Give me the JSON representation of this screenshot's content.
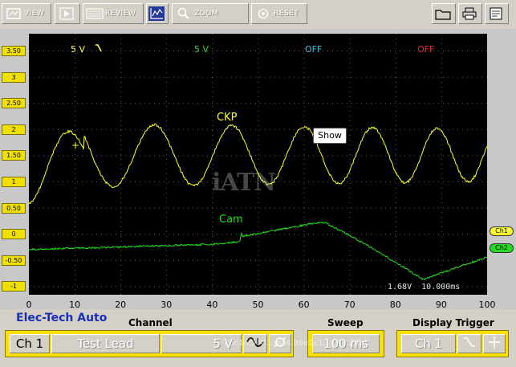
{
  "toolbar": {
    "view_label": "VIEW",
    "review_label": "REVIEW",
    "zoom_label": "ZOOM",
    "reset_label": "RESET"
  },
  "channels_header": {
    "ch1_scale": "5 V",
    "ch2_scale": "5 V",
    "ch3_state": "OFF",
    "ch4_state": "OFF"
  },
  "colors": {
    "ch1": "#ffff30",
    "ch2": "#22dd22",
    "ch3": "#40c0e0",
    "ch4": "#e03030",
    "grid": "#606060",
    "brand": "#1a2fb8"
  },
  "y_axis_labels": [
    "3.50",
    "3",
    "2.50",
    "2",
    "1.50",
    "1",
    "0.50",
    "0",
    "-0.50",
    "-1"
  ],
  "x_axis_labels": [
    "0",
    "10",
    "20",
    "30",
    "40",
    "50",
    "60",
    "70",
    "80",
    "90",
    "100"
  ],
  "traces": {
    "ckp_label": "CKP",
    "cam_label": "Cam"
  },
  "tooltip": {
    "text": "Show"
  },
  "watermark": {
    "text": "iATN"
  },
  "cursor_readout": {
    "voltage": "1.68V",
    "time": "10.000ms"
  },
  "markers": {
    "ch1": "Ch1",
    "ch2": "Ch2"
  },
  "bottom": {
    "brand": "Elec-Tech Auto",
    "channel_title": "Channel",
    "sweep_title": "Sweep",
    "trigger_title": "Display Trigger",
    "channel_select": "Ch 1",
    "probe": "Test Lead",
    "scale": "5 V",
    "sweep_value": "100 ms",
    "trigger_channel": "Ch 1",
    "url_overlay": "coc1rc9.4l...ms4.98e2c1.1148.2ffbf"
  }
}
